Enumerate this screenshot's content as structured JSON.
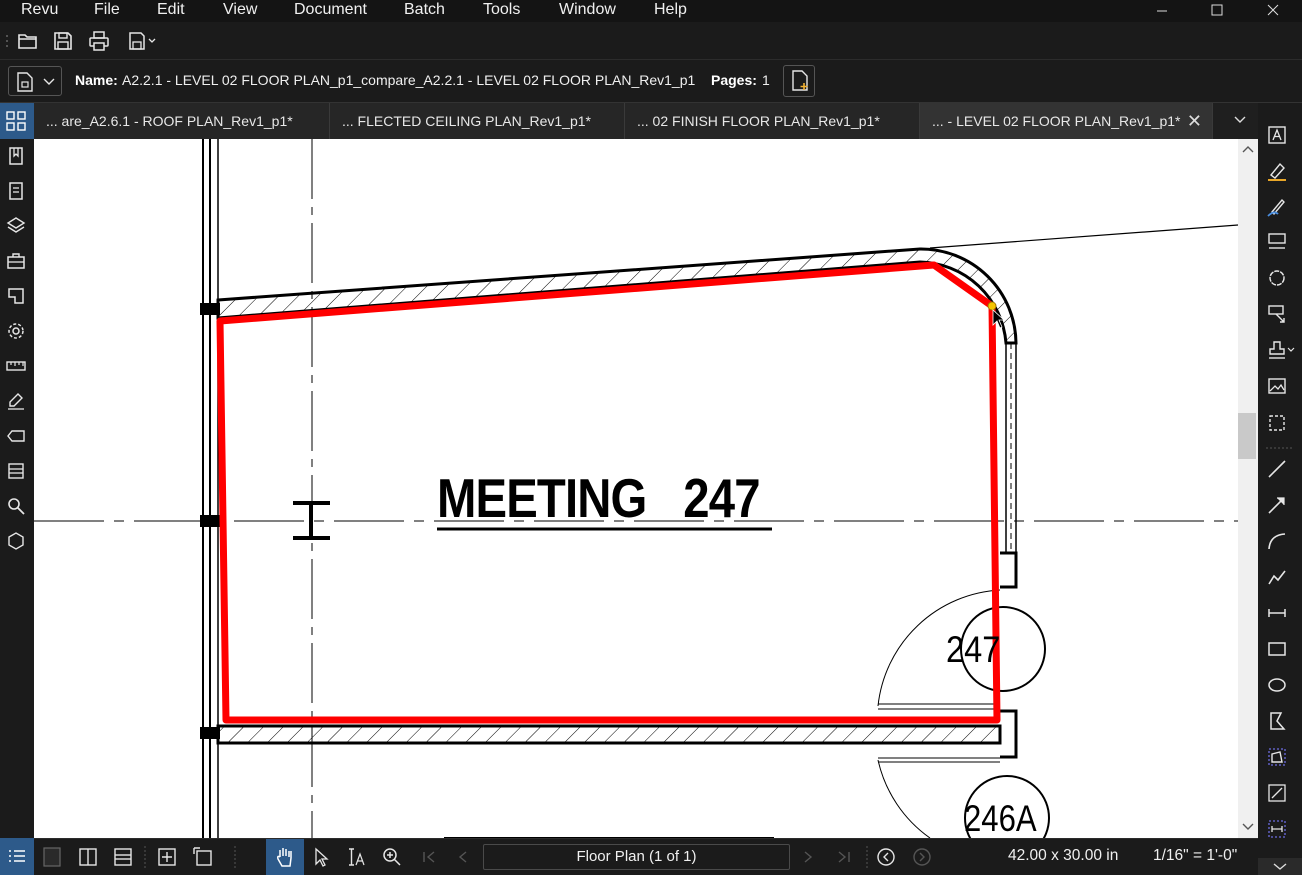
{
  "menubar": {
    "items": [
      "Revu",
      "File",
      "Edit",
      "View",
      "Document",
      "Batch",
      "Tools",
      "Window",
      "Help"
    ]
  },
  "window_controls": [
    "minimize-icon",
    "maximize-icon",
    "close-icon"
  ],
  "quick_toolbar": [
    "open-folder-icon",
    "save-icon",
    "print-icon",
    "save-as-dropdown-icon"
  ],
  "docinfo": {
    "name_label": "Name:",
    "name_value": "A2.2.1 - LEVEL 02 FLOOR PLAN_p1_compare_A2.2.1 - LEVEL 02 FLOOR PLAN_Rev1_p1",
    "pages_label": "Pages:",
    "pages_value": "1"
  },
  "tabs": [
    {
      "label": "... are_A2.6.1 - ROOF PLAN_Rev1_p1*",
      "active": false
    },
    {
      "label": "... FLECTED CEILING PLAN_Rev1_p1*",
      "active": false
    },
    {
      "label": "...  02 FINISH FLOOR PLAN_Rev1_p1*",
      "active": false
    },
    {
      "label": "... - LEVEL 02 FLOOR PLAN_Rev1_p1*",
      "active": true
    }
  ],
  "drawing": {
    "room_name": "MEETING   247",
    "tag_primary": "247",
    "tag_secondary": "246A",
    "markup_color": "#ff0000"
  },
  "statusbar": {
    "page_label": "Floor Plan (1 of 1)",
    "page_size": "42.00 x 30.00 in",
    "scale": "1/16\" = 1'-0\""
  },
  "colors": {
    "accent": "#2d5a8a",
    "chrome_bg": "#1b1b1b",
    "canvas_bg": "#ffffff"
  }
}
